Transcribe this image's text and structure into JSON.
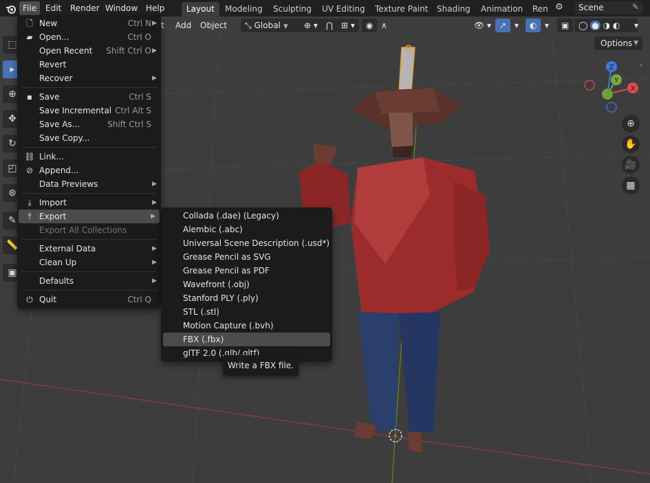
{
  "topbar": {
    "menus": [
      "File",
      "Edit",
      "Render",
      "Window",
      "Help"
    ],
    "workspaces": [
      "Layout",
      "Modeling",
      "Sculpting",
      "UV Editing",
      "Texture Paint",
      "Shading",
      "Animation",
      "Ren"
    ],
    "active_workspace": "Layout",
    "scene_name": "Scene"
  },
  "viewport_header": {
    "add_label": "Add",
    "object_label": "Object",
    "partial_label": "t",
    "orientation": "Global",
    "options_label": "Options"
  },
  "gizmo": {
    "x_label": "X",
    "y_label": "Y",
    "z_label": "Z"
  },
  "file_menu": {
    "items": [
      {
        "label": "New",
        "shortcut": "Ctrl N",
        "icon": "new-file-icon",
        "submenu": true
      },
      {
        "label": "Open...",
        "shortcut": "Ctrl O",
        "icon": "folder-icon",
        "submenu": false
      },
      {
        "label": "Open Recent",
        "shortcut": "Shift Ctrl O",
        "icon": "",
        "submenu": true
      },
      {
        "label": "Revert",
        "shortcut": "",
        "icon": "",
        "submenu": false
      },
      {
        "label": "Recover",
        "shortcut": "",
        "icon": "",
        "submenu": true
      },
      {
        "label": "Save",
        "shortcut": "Ctrl S",
        "icon": "save-icon",
        "submenu": false
      },
      {
        "label": "Save Incremental",
        "shortcut": "Ctrl Alt S",
        "icon": "",
        "submenu": false
      },
      {
        "label": "Save As...",
        "shortcut": "Shift Ctrl S",
        "icon": "",
        "submenu": false
      },
      {
        "label": "Save Copy...",
        "shortcut": "",
        "icon": "",
        "submenu": false
      },
      {
        "label": "Link...",
        "shortcut": "",
        "icon": "link-icon",
        "submenu": false
      },
      {
        "label": "Append...",
        "shortcut": "",
        "icon": "append-icon",
        "submenu": false
      },
      {
        "label": "Data Previews",
        "shortcut": "",
        "icon": "",
        "submenu": true
      },
      {
        "label": "Import",
        "shortcut": "",
        "icon": "import-icon",
        "submenu": true
      },
      {
        "label": "Export",
        "shortcut": "",
        "icon": "export-icon",
        "submenu": true
      },
      {
        "label": "Export All Collections",
        "shortcut": "",
        "icon": "",
        "submenu": false
      },
      {
        "label": "External Data",
        "shortcut": "",
        "icon": "",
        "submenu": true
      },
      {
        "label": "Clean Up",
        "shortcut": "",
        "icon": "",
        "submenu": true
      },
      {
        "label": "Defaults",
        "shortcut": "",
        "icon": "",
        "submenu": true
      },
      {
        "label": "Quit",
        "shortcut": "Ctrl Q",
        "icon": "power-icon",
        "submenu": false
      }
    ]
  },
  "export_menu": {
    "items": [
      "Collada (.dae) (Legacy)",
      "Alembic (.abc)",
      "Universal Scene Description (.usd*)",
      "Grease Pencil as SVG",
      "Grease Pencil as PDF",
      "Wavefront (.obj)",
      "Stanford PLY (.ply)",
      "STL (.stl)",
      "Motion Capture (.bvh)",
      "FBX (.fbx)",
      "glTF 2.0 (.glb/.gltf)"
    ],
    "highlighted": "FBX (.fbx)"
  },
  "tooltip": {
    "text": "Write a FBX file."
  },
  "colors": {
    "accent": "#4772b3",
    "menu_bg": "#1b1b1b",
    "viewport_bg": "#3d3d3d"
  }
}
